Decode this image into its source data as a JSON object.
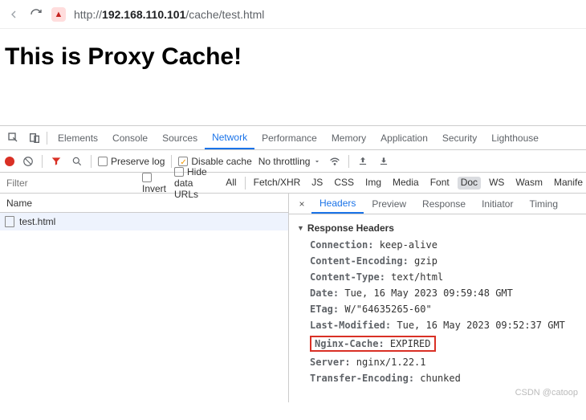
{
  "browser": {
    "url_protocol": "http://",
    "url_host": "192.168.110.101",
    "url_path": "/cache/test.html"
  },
  "page": {
    "heading": "This is Proxy Cache!"
  },
  "devtools": {
    "tabs": [
      "Elements",
      "Console",
      "Sources",
      "Network",
      "Performance",
      "Memory",
      "Application",
      "Security",
      "Lighthouse"
    ],
    "active_tab": "Network",
    "toolbar": {
      "preserve_log": "Preserve log",
      "disable_cache": "Disable cache",
      "throttling": "No throttling"
    },
    "filter": {
      "placeholder": "Filter",
      "invert": "Invert",
      "hide_data_urls": "Hide data URLs",
      "types": [
        "All",
        "Fetch/XHR",
        "JS",
        "CSS",
        "Img",
        "Media",
        "Font",
        "Doc",
        "WS",
        "Wasm",
        "Manife"
      ],
      "active_type": "Doc"
    },
    "req_list": {
      "col_name": "Name",
      "items": [
        "test.html"
      ]
    },
    "detail": {
      "tabs": [
        "Headers",
        "Preview",
        "Response",
        "Initiator",
        "Timing"
      ],
      "active_tab": "Headers",
      "section_title": "Response Headers",
      "headers": [
        {
          "k": "Connection:",
          "v": "keep-alive"
        },
        {
          "k": "Content-Encoding:",
          "v": "gzip"
        },
        {
          "k": "Content-Type:",
          "v": "text/html"
        },
        {
          "k": "Date:",
          "v": "Tue, 16 May 2023 09:59:48 GMT"
        },
        {
          "k": "ETag:",
          "v": "W/\"64635265-60\""
        },
        {
          "k": "Last-Modified:",
          "v": "Tue, 16 May 2023 09:52:37 GMT"
        },
        {
          "k": "Nginx-Cache:",
          "v": "EXPIRED",
          "highlight": true
        },
        {
          "k": "Server:",
          "v": "nginx/1.22.1"
        },
        {
          "k": "Transfer-Encoding:",
          "v": "chunked"
        }
      ]
    }
  },
  "watermark": "CSDN @catoop"
}
